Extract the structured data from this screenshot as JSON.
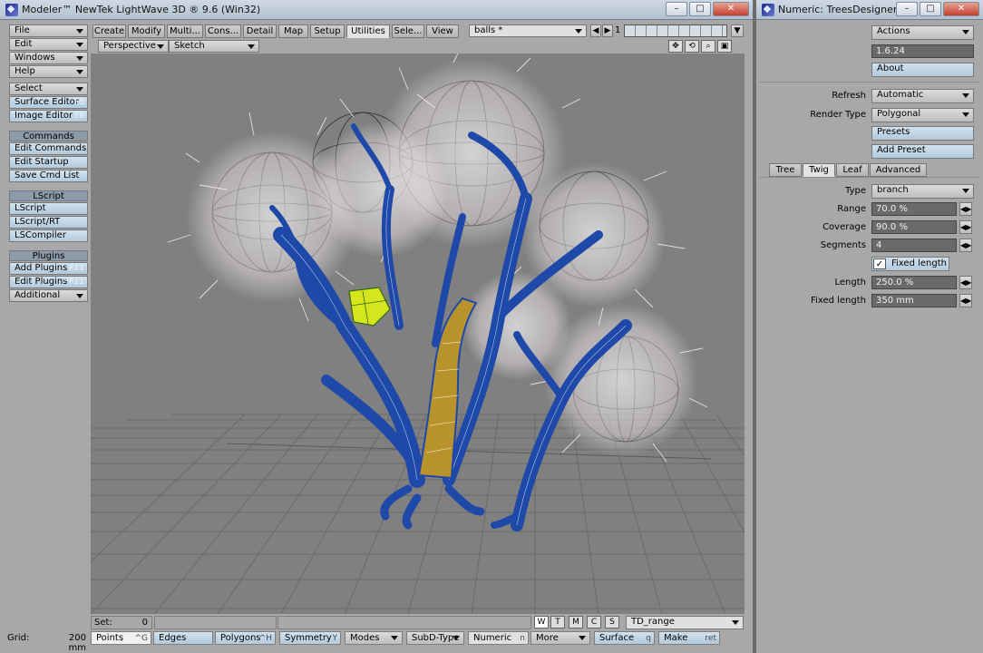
{
  "main_window": {
    "title": "Modeler™ NewTek LightWave 3D ® 9.6  (Win32)",
    "controls": {
      "minimize": "–",
      "maximize": "□",
      "close": "✕"
    }
  },
  "numeric_window": {
    "title": "Numeric: TreesDesigner ...",
    "controls": {
      "minimize": "–",
      "maximize": "□",
      "close": "✕"
    }
  },
  "left_menu": {
    "file": "File",
    "edit": "Edit",
    "windows": "Windows",
    "help": "Help",
    "select": "Select",
    "surface_editor": "Surface Editor",
    "surface_editor_key": "F5",
    "image_editor": "Image Editor",
    "image_editor_key": "F6",
    "commands_header": "Commands",
    "edit_commands": "Edit Commands",
    "edit_startup": "Edit Startup",
    "save_cmd_list": "Save Cmd List",
    "lscript_header": "LScript",
    "lscript": "LScript",
    "lscript_rt": "LScript/RT",
    "lscompiler": "LSCompiler",
    "plugins_header": "Plugins",
    "add_plugins": "Add Plugins",
    "add_plugins_key": "F11",
    "edit_plugins": "Edit Plugins",
    "edit_plugins_key": "^F11",
    "additional": "Additional"
  },
  "tabs": [
    "Create",
    "Modify",
    "Multi...",
    "Cons...",
    "Detail",
    "Map",
    "Setup",
    "Utilities",
    "Sele...",
    "View"
  ],
  "selected_tab": "Utilities",
  "layer_select": "balls *",
  "layer_number": "1",
  "viewport": {
    "view_mode": "Perspective",
    "render_mode": "Sketch",
    "icons": [
      "move-view-icon",
      "rotate-view-icon",
      "zoom-view-icon",
      "maximize-view-icon"
    ]
  },
  "numeric": {
    "actions": "Actions",
    "version": "1.6.24",
    "about": "About",
    "refresh_label": "Refresh",
    "refresh_value": "Automatic",
    "render_type_label": "Render Type",
    "render_type_value": "Polygonal",
    "presets": "Presets",
    "add_preset": "Add Preset",
    "subtabs": [
      "Tree",
      "Twig",
      "Leaf",
      "Advanced"
    ],
    "selected_subtab": "Twig",
    "type_label": "Type",
    "type_value": "branch",
    "range_label": "Range",
    "range_value": "70.0 %",
    "coverage_label": "Coverage",
    "coverage_value": "90.0 %",
    "segments_label": "Segments",
    "segments_value": "4",
    "fixed_length_check": "Fixed length",
    "fixed_length_checked": true,
    "length_label": "Length",
    "length_value": "250.0 %",
    "fixed_length_label": "Fixed length",
    "fixed_length_value": "350 mm"
  },
  "status_bar": {
    "set_label": "Set:",
    "set_value": "0",
    "wtmcs": [
      "W",
      "T",
      "M",
      "C",
      "S"
    ],
    "weight_map": "TD_range",
    "grid_label": "Grid:",
    "grid_value": "200 mm",
    "points": "Points",
    "points_key": "^G",
    "edges": "Edges",
    "polygons": "Polygons",
    "polygons_key": "^H",
    "symmetry": "Symmetry",
    "symmetry_key": "Y",
    "modes": "Modes",
    "subd_type": "SubD-Type",
    "numeric": "Numeric",
    "numeric_key": "n",
    "more": "More",
    "surface": "Surface",
    "surface_key": "q",
    "make": "Make",
    "make_key": "ret"
  },
  "colors": {
    "branch_blue": "#2a5fb8",
    "trunk_gold": "#b8922a",
    "selection_yellow": "#d7e51c",
    "viewport_bg": "#808080",
    "panel_bg": "#a8a8a8"
  }
}
